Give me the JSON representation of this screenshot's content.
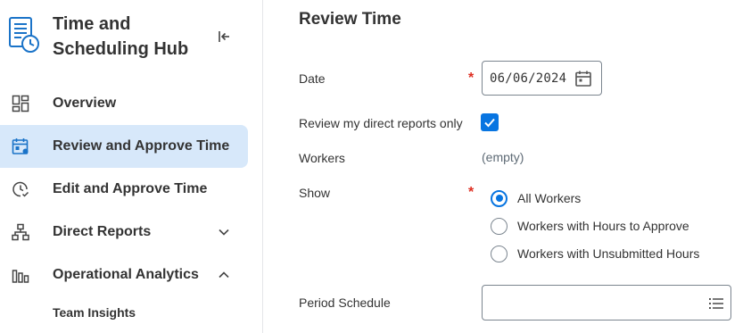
{
  "sidebar": {
    "hub_title": "Time and Scheduling Hub",
    "collapse_icon": "collapse-left-icon",
    "items": [
      {
        "label": "Overview",
        "icon": "dashboard-icon",
        "active": false
      },
      {
        "label": "Review and Approve Time",
        "icon": "calendar-user-icon",
        "active": true
      },
      {
        "label": "Edit and Approve Time",
        "icon": "clock-check-icon",
        "active": false
      },
      {
        "label": "Direct Reports",
        "icon": "org-chart-icon",
        "active": false,
        "chevron": "chevron-down-icon"
      },
      {
        "label": "Operational Analytics",
        "icon": "bar-chart-icon",
        "active": false,
        "chevron": "chevron-up-icon"
      }
    ],
    "sub_items": [
      {
        "label": "Team Insights"
      }
    ]
  },
  "main": {
    "title": "Review Time",
    "date": {
      "label": "Date",
      "required": "*",
      "value": "06/06/2024"
    },
    "direct_reports": {
      "label": "Review my direct reports only",
      "checked": true
    },
    "workers": {
      "label": "Workers",
      "value": "(empty)"
    },
    "show": {
      "label": "Show",
      "required": "*",
      "options": [
        {
          "label": "All Workers",
          "selected": true
        },
        {
          "label": "Workers with Hours to Approve",
          "selected": false
        },
        {
          "label": "Workers with Unsubmitted Hours",
          "selected": false
        }
      ]
    },
    "period_schedule": {
      "label": "Period Schedule",
      "value": ""
    }
  },
  "colors": {
    "accent": "#0875e1",
    "active_bg": "#d7e8fa",
    "required": "#de2e21",
    "text": "#333333"
  }
}
